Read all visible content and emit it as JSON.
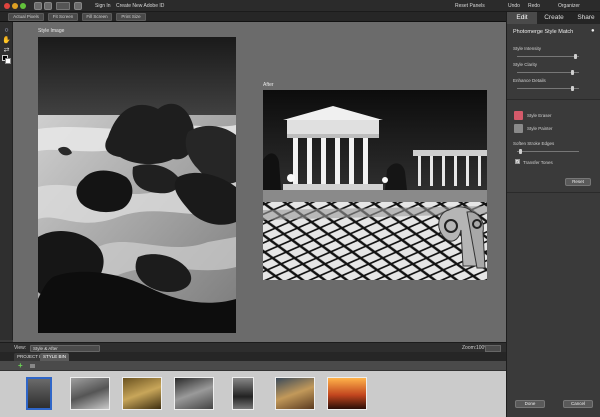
{
  "menubar": {
    "sign_in": "Sign In",
    "create_adobe_id": "Create New Adobe ID",
    "reset_panels": "Reset Panels",
    "undo": "Undo",
    "redo": "Redo",
    "organizer": "Organizer"
  },
  "viewbar": {
    "buttons": [
      "Actual Pixels",
      "Fit Screen",
      "Fill Screen",
      "Print Size"
    ]
  },
  "canvas": {
    "left_label": "Style Image",
    "right_label": "After"
  },
  "statusbar": {
    "view_label": "View:",
    "view_value": "Style & After",
    "zoom_label": "Zoom:",
    "zoom_value": "100%"
  },
  "bin": {
    "tabs": [
      "PROJECT BIN",
      "STYLE BIN"
    ],
    "active_tab": "STYLE BIN"
  },
  "panel": {
    "tabs": [
      "Edit",
      "Create",
      "Share"
    ],
    "active_tab": "Edit",
    "title": "Photomerge Style Match",
    "sliders": [
      {
        "label": "Style Intensity",
        "value": 0.95
      },
      {
        "label": "Style Clarity",
        "value": 0.9
      },
      {
        "label": "Enhance Details",
        "value": 0.9
      }
    ],
    "tools": [
      "Style Eraser",
      "Style Painter"
    ],
    "soften_label": "Soften Stroke Edges",
    "soften_value": 0.05,
    "transfer_tones_label": "Transfer Tones",
    "transfer_tones_checked": true,
    "reset_label": "Reset",
    "done_label": "Done",
    "cancel_label": "Cancel"
  },
  "colors": {
    "accent_edit_tab": "#4a4a4a",
    "eraser_icon": "#d45a6a",
    "painter_icon": "#8a8a8a"
  }
}
